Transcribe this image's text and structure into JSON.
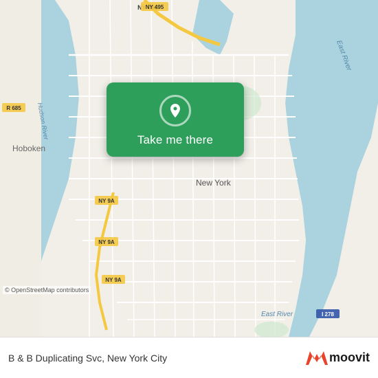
{
  "map": {
    "alt": "Map of New York City area"
  },
  "card": {
    "button_label": "Take me there"
  },
  "bottom_bar": {
    "place_name": "B & B Duplicating Svc, New York City",
    "logo_letter": "m",
    "logo_text": "moovit"
  },
  "credits": {
    "osm": "© OpenStreetMap contributors"
  },
  "colors": {
    "card_green": "#2e9e5b",
    "road_yellow": "#f5c842",
    "road_white": "#ffffff",
    "water_blue": "#aad3df",
    "land": "#f2efe9"
  }
}
